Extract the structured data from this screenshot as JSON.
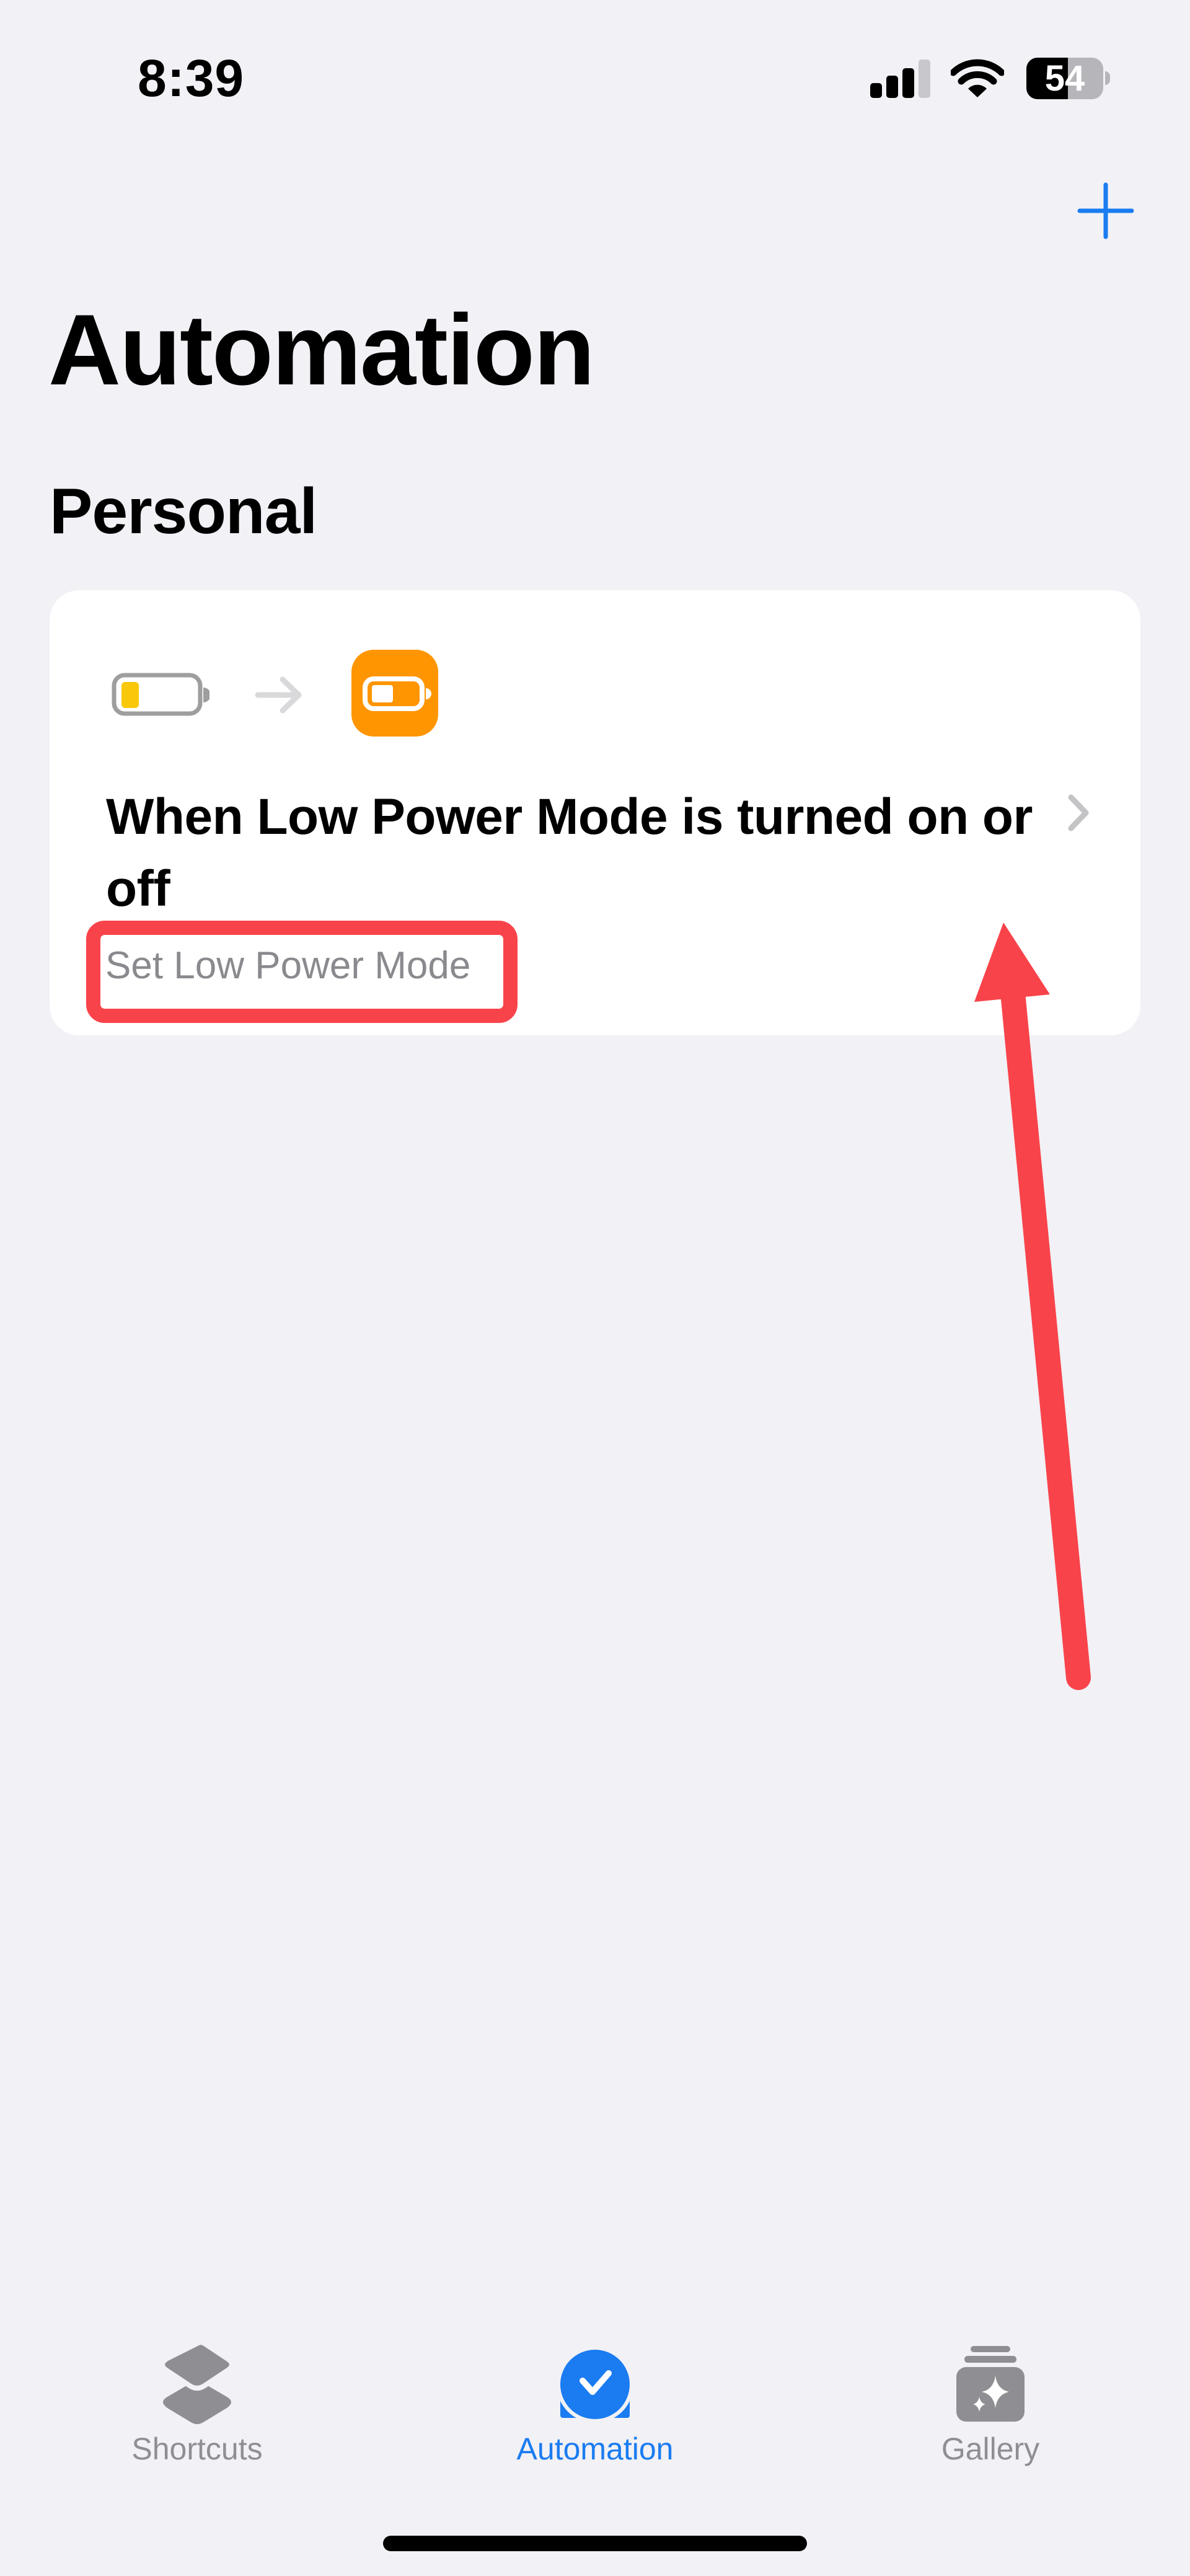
{
  "status_bar": {
    "time": "8:39",
    "signal_bars_active": 3,
    "signal_bars_total": 4,
    "battery_percent": 54,
    "battery_label": "54",
    "icons": [
      "cellular-signal-icon",
      "wifi-icon",
      "battery-icon"
    ]
  },
  "nav": {
    "add_button_icon": "plus-icon",
    "title": "Automation"
  },
  "section": {
    "title": "Personal"
  },
  "automations": [
    {
      "trigger_icon": "low-battery-icon",
      "flow_icon": "arrow-right-icon",
      "action_icon": "low-power-mode-icon",
      "title": "When Low Power Mode is turned on or off",
      "subtitle": "Set Low Power Mode",
      "disclosure_icon": "chevron-right-icon"
    }
  ],
  "annotation": {
    "highlight_target": "Set Low Power Mode",
    "color": "#f9434a"
  },
  "tab_bar": {
    "tabs": [
      {
        "label": "Shortcuts",
        "icon": "stacked-squares-icon",
        "active": false
      },
      {
        "label": "Automation",
        "icon": "clock-check-icon",
        "active": true
      },
      {
        "label": "Gallery",
        "icon": "sparkles-stack-icon",
        "active": false
      }
    ]
  },
  "colors": {
    "accent": "#1a7cf0",
    "background": "#f1f1f6",
    "card": "#ffffff",
    "action_icon_bg": "#ff9500",
    "battery_level": "#f9c80a",
    "secondary_text": "#8a8a8e",
    "tab_inactive": "#8e8e93"
  }
}
